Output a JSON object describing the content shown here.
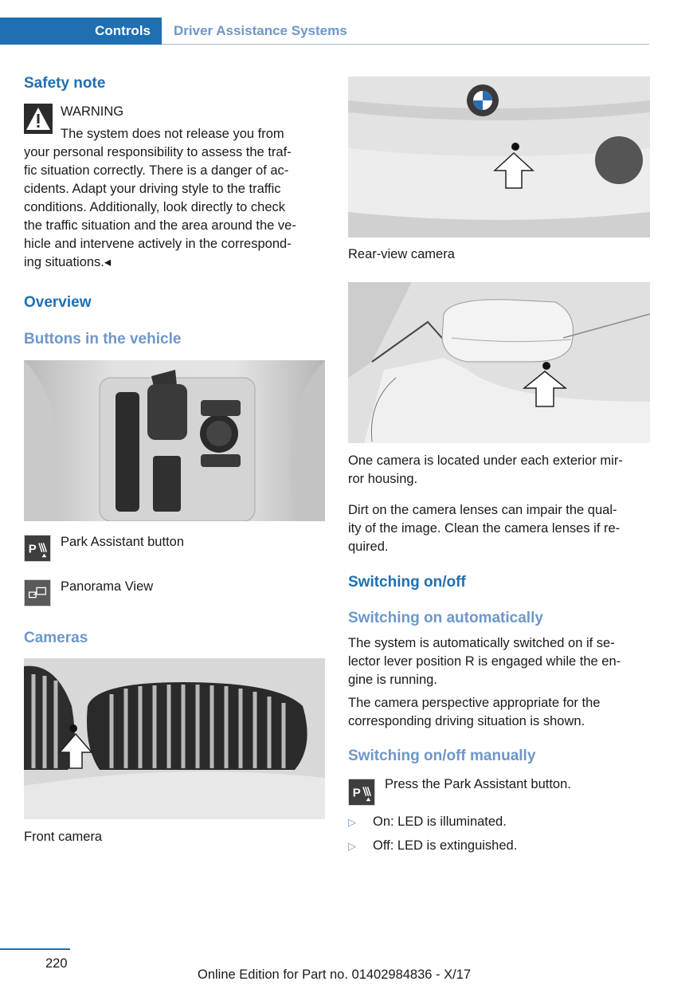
{
  "header": {
    "tab": "Controls",
    "section": "Driver Assistance Systems"
  },
  "left": {
    "safety_heading": "Safety note",
    "warning_label": "WARNING",
    "warning_first_line": "The system does not release you from",
    "warning_lines": [
      "your personal responsibility to assess the traf-",
      "fic situation correctly. There is a danger of ac-",
      "cidents. Adapt your driving style to the traffic",
      "conditions. Additionally, look directly to check",
      "the traffic situation and the area around the ve-",
      "hicle and intervene actively in the correspond-",
      "ing situations.◂"
    ],
    "overview_heading": "Overview",
    "buttons_heading": "Buttons in the vehicle",
    "park_assistant_label": "Park Assistant button",
    "panorama_label": "Panorama View",
    "cameras_heading": "Cameras",
    "front_camera_caption": "Front camera"
  },
  "right": {
    "rear_camera_caption": "Rear-view camera",
    "mirror_caption_lines": [
      "One camera is located under each exterior mir-",
      "ror housing."
    ],
    "dirt_lines": [
      "Dirt on the camera lenses can impair the qual-",
      "ity of the image. Clean the camera lenses if re-",
      "quired."
    ],
    "switching_heading": "Switching on/off",
    "auto_heading": "Switching on automatically",
    "auto_lines": [
      "The system is automatically switched on if se-",
      "lector lever position R is engaged while the en-",
      "gine is running."
    ],
    "perspective_lines": [
      "The camera perspective appropriate for the",
      "corresponding driving situation is shown."
    ],
    "manual_heading": "Switching on/off manually",
    "press_text": "Press the Park Assistant button.",
    "bullets": [
      "On: LED is illuminated.",
      "Off: LED is extinguished."
    ]
  },
  "footer": {
    "page_number": "220",
    "edition": "Online Edition for Part no. 01402984836 - X/17"
  },
  "colors": {
    "accent": "#1f6fb2",
    "subheading": "#6d97c8"
  },
  "icons": [
    "warning-icon",
    "park-assistant-icon",
    "panorama-view-icon"
  ]
}
